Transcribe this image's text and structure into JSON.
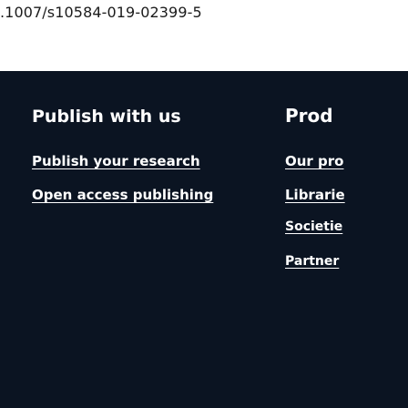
{
  "doi_text": ".1007/s10584-019-02399-5",
  "footer": {
    "publish_column": {
      "heading": "Publish with us",
      "links": [
        "Publish your research",
        "Open access publishing"
      ]
    },
    "products_column": {
      "heading": "Prod",
      "links": [
        "Our pro",
        "Librarie",
        "Societie",
        "Partner"
      ]
    }
  },
  "colors": {
    "footer_background": "#0b1422",
    "footer_text": "#ffffff"
  }
}
